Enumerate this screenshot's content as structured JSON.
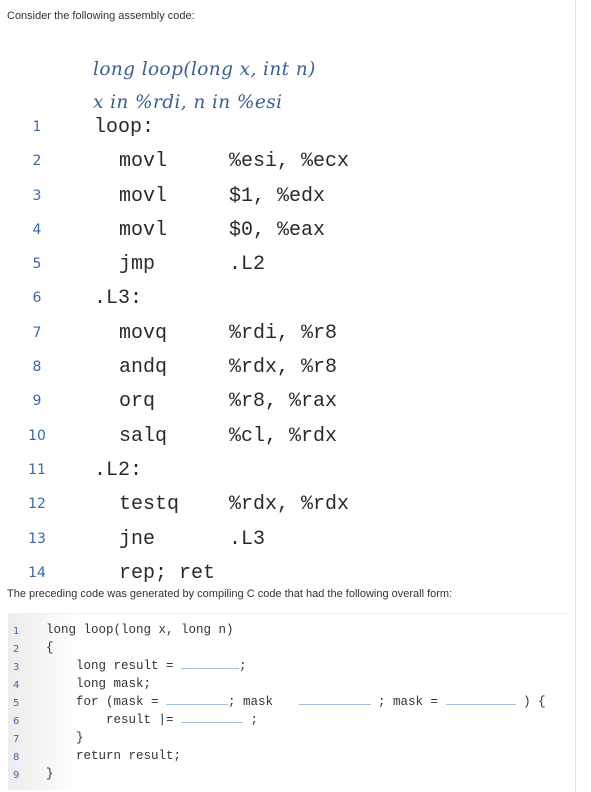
{
  "intro_text": "Consider the following assembly code:",
  "asm": {
    "signature": "long loop(long x, int n)",
    "register_note": "x in %rdi, n in %esi",
    "lines": [
      {
        "num": "1",
        "label": "loop:",
        "op": "",
        "args": ""
      },
      {
        "num": "2",
        "label": "",
        "op": "movl",
        "args": "%esi, %ecx"
      },
      {
        "num": "3",
        "label": "",
        "op": "movl",
        "args": "$1, %edx"
      },
      {
        "num": "4",
        "label": "",
        "op": "movl",
        "args": "$0, %eax"
      },
      {
        "num": "5",
        "label": "",
        "op": "jmp",
        "args": ".L2"
      },
      {
        "num": "6",
        "label": ".L3:",
        "op": "",
        "args": ""
      },
      {
        "num": "7",
        "label": "",
        "op": "movq",
        "args": "%rdi, %r8"
      },
      {
        "num": "8",
        "label": "",
        "op": "andq",
        "args": "%rdx, %r8"
      },
      {
        "num": "9",
        "label": "",
        "op": "orq",
        "args": "%r8, %rax"
      },
      {
        "num": "10",
        "label": "",
        "op": "salq",
        "args": "%cl, %rdx"
      },
      {
        "num": "11",
        "label": ".L2:",
        "op": "",
        "args": ""
      },
      {
        "num": "12",
        "label": "",
        "op": "testq",
        "args": "%rdx, %rdx"
      },
      {
        "num": "13",
        "label": "",
        "op": "jne",
        "args": ".L3"
      },
      {
        "num": "14",
        "label": "",
        "op": "rep; ret",
        "args": ""
      }
    ]
  },
  "preceding_text": "The preceding code was generated by compiling C code that had the following overall form:",
  "c_code": {
    "line_numbers": [
      "1",
      "2",
      "3",
      "4",
      "5",
      "6",
      "7",
      "8",
      "9"
    ],
    "l1": "long loop(long x, long n)",
    "l2": "{",
    "l3_pre": "    long result = ",
    "l3_post": ";",
    "l4": "    long mask;",
    "l5_pre": "    for (mask = ",
    "l5_mid1": "; mask ",
    "l5_mid2": " ; mask = ",
    "l5_post": " ) {",
    "l6_pre": "        result |= ",
    "l6_post": " ;",
    "l7": "    }",
    "l8": "    return result;",
    "l9": "}"
  }
}
